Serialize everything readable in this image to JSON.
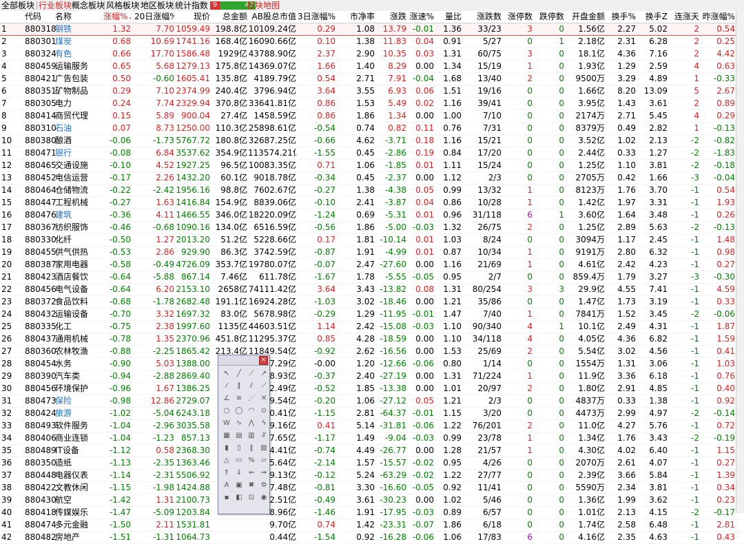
{
  "tabs": [
    {
      "label": "全部板块",
      "active": false
    },
    {
      "label": "行业板块",
      "active": true
    },
    {
      "label": "概念板块",
      "active": false
    },
    {
      "label": "风格板块",
      "active": false
    },
    {
      "label": "地区板块",
      "active": false
    },
    {
      "label": "统计指数",
      "active": false
    }
  ],
  "indicator": {
    "up": "9",
    "down": "47"
  },
  "map_tab": "板块地图",
  "columns": {
    "idx": "",
    "code": "代码",
    "name": "名称",
    "chg": "涨幅%↓",
    "chg20": "20日涨幅%",
    "price": "现价",
    "amt": "总金额",
    "mcap": "AB股总市值",
    "chg3": "3日涨幅%",
    "pb": "市净率",
    "updn": "涨跌",
    "speed": "涨速%",
    "vr": "量比",
    "ratio": "涨跌数",
    "lu": "涨停数",
    "ld": "跌停数",
    "open": "开盘金额",
    "turn": "换手%",
    "turn2": "换手Z",
    "cons": "连涨天",
    "yest": "昨涨幅%"
  },
  "rows": [
    [
      "1",
      "880318",
      "钢铁",
      "1.32",
      "7.70",
      "1059.49",
      "198.8亿",
      "10109.24亿",
      "0.29",
      "1.08",
      "13.79",
      "-0.01",
      "1.36",
      "33/23",
      "3",
      "0",
      "1.56亿",
      "2.27",
      "5.02",
      "2",
      "0.54"
    ],
    [
      "2",
      "880301",
      "煤炭",
      "0.68",
      "10.69",
      "1741.16",
      "168.4亿",
      "16090.66亿",
      "0.10",
      "1.38",
      "11.83",
      "0.04",
      "0.91",
      "5/27",
      "0",
      "1",
      "2.18亿",
      "2.31",
      "6.28",
      "2",
      "0.25"
    ],
    [
      "3",
      "880324",
      "有色",
      "0.66",
      "17.70",
      "1586.48",
      "1929亿",
      "43788.90亿",
      "2.37",
      "2.90",
      "10.35",
      "0.03",
      "1.31",
      "60/75",
      "3",
      "0",
      "18.1亿",
      "4.36",
      "7.16",
      "2",
      "4.42"
    ],
    [
      "4",
      "880459",
      "运输服务",
      "0.65",
      "5.68",
      "1279.13",
      "175.8亿",
      "14369.07亿",
      "1.66",
      "1.40",
      "8.29",
      "0.00",
      "1.34",
      "15/19",
      "1",
      "0",
      "1.93亿",
      "1.29",
      "2.59",
      "4",
      "0.63"
    ],
    [
      "5",
      "880421",
      "广告包装",
      "0.50",
      "-0.60",
      "1605.41",
      "135.8亿",
      "4189.79亿",
      "0.54",
      "2.71",
      "7.91",
      "-0.04",
      "1.68",
      "13/40",
      "2",
      "0",
      "9500万",
      "3.29",
      "4.89",
      "1",
      "-0.33"
    ],
    [
      "6",
      "880351",
      "矿物制品",
      "0.29",
      "7.10",
      "2374.99",
      "240.4亿",
      "3796.94亿",
      "3.64",
      "3.55",
      "6.93",
      "0.06",
      "1.51",
      "19/16",
      "0",
      "0",
      "1.66亿",
      "8.20",
      "13.09",
      "5",
      "2.67"
    ],
    [
      "7",
      "880305",
      "电力",
      "0.24",
      "7.74",
      "2329.94",
      "370.8亿",
      "33641.81亿",
      "0.86",
      "1.53",
      "5.49",
      "0.02",
      "1.16",
      "39/41",
      "0",
      "0",
      "3.95亿",
      "1.43",
      "3.61",
      "2",
      "0.89"
    ],
    [
      "8",
      "880414",
      "商贸代理",
      "0.15",
      "5.89",
      "900.04",
      "27.4亿",
      "1458.59亿",
      "0.86",
      "1.86",
      "1.34",
      "0.00",
      "1.00",
      "7/10",
      "0",
      "0",
      "2174万",
      "2.71",
      "5.45",
      "4",
      "0.29"
    ],
    [
      "9",
      "880310",
      "石油",
      "0.07",
      "8.73",
      "1250.00",
      "110.3亿",
      "25898.61亿",
      "-0.54",
      "0.74",
      "0.82",
      "0.11",
      "0.76",
      "7/31",
      "0",
      "0",
      "8379万",
      "0.49",
      "2.82",
      "1",
      "-0.13"
    ],
    [
      "10",
      "880380",
      "酿酒",
      "-0.06",
      "-1.73",
      "5767.72",
      "180.8亿",
      "32687.25亿",
      "-0.66",
      "4.62",
      "-3.71",
      "0.18",
      "1.16",
      "15/21",
      "0",
      "0",
      "3.52亿",
      "1.02",
      "2.13",
      "-2",
      "-0.82"
    ],
    [
      "11",
      "880471",
      "银行",
      "-0.08",
      "6.84",
      "3537.62",
      "354.9亿",
      "113574.21亿",
      "-1.55",
      "0.45",
      "-2.86",
      "0.19",
      "0.84",
      "17/20",
      "0",
      "0",
      "2.44亿",
      "0.33",
      "1.27",
      "-2",
      "-1.83"
    ],
    [
      "12",
      "880465",
      "交通设施",
      "-0.10",
      "4.52",
      "1927.25",
      "96.5亿",
      "10083.35亿",
      "0.71",
      "1.06",
      "-1.85",
      "0.01",
      "1.11",
      "15/24",
      "0",
      "0",
      "1.25亿",
      "1.10",
      "3.81",
      "-2",
      "-0.18"
    ],
    [
      "13",
      "880452",
      "电信运营",
      "-0.17",
      "2.26",
      "1432.20",
      "60.1亿",
      "9018.78亿",
      "-0.34",
      "0.45",
      "-2.37",
      "0.00",
      "1.12",
      "2/3",
      "0",
      "0",
      "2705万",
      "0.42",
      "1.66",
      "-3",
      "-0.04"
    ],
    [
      "14",
      "880464",
      "仓储物流",
      "-0.22",
      "-2.42",
      "1956.16",
      "98.8亿",
      "7602.67亿",
      "-0.27",
      "1.38",
      "-4.38",
      "0.05",
      "0.99",
      "13/32",
      "1",
      "0",
      "8123万",
      "1.76",
      "3.70",
      "-1",
      "0.54"
    ],
    [
      "15",
      "880447",
      "工程机械",
      "-0.27",
      "1.63",
      "1416.84",
      "154.9亿",
      "8839.06亿",
      "-0.10",
      "2.41",
      "-3.87",
      "0.04",
      "0.86",
      "10/28",
      "1",
      "0",
      "1.42亿",
      "1.97",
      "3.31",
      "-1",
      "1.93"
    ],
    [
      "16",
      "880476",
      "建筑",
      "-0.36",
      "4.11",
      "1466.55",
      "346.0亿",
      "18220.09亿",
      "-1.24",
      "0.69",
      "-5.31",
      "0.01",
      "0.96",
      "31/118",
      "6",
      "1",
      "3.60亿",
      "1.64",
      "3.48",
      "-1",
      "0.26"
    ],
    [
      "17",
      "880367",
      "纺织服饰",
      "-0.46",
      "-0.68",
      "1090.16",
      "134.0亿",
      "6516.59亿",
      "-0.56",
      "1.86",
      "-5.00",
      "-0.03",
      "1.32",
      "26/75",
      "2",
      "0",
      "1.25亿",
      "2.89",
      "5.63",
      "-2",
      "-0.13"
    ],
    [
      "18",
      "880330",
      "化纤",
      "-0.50",
      "1.27",
      "2013.20",
      "51.2亿",
      "5228.66亿",
      "0.17",
      "1.81",
      "-10.14",
      "0.01",
      "1.03",
      "8/24",
      "0",
      "0",
      "3094万",
      "1.17",
      "2.45",
      "-1",
      "1.48"
    ],
    [
      "19",
      "880455",
      "供气供热",
      "-0.53",
      "2.86",
      "929.90",
      "86.3亿",
      "3742.59亿",
      "-0.87",
      "1.91",
      "-4.99",
      "0.01",
      "0.87",
      "10/34",
      "1",
      "0",
      "9191万",
      "2.80",
      "6.32",
      "-1",
      "0.98"
    ],
    [
      "20",
      "880387",
      "家用电器",
      "-0.58",
      "-0.49",
      "4726.09",
      "353.7亿",
      "19780.07亿",
      "-0.07",
      "2.47",
      "-27.60",
      "0.00",
      "1.16",
      "21/69",
      "1",
      "0",
      "4.61亿",
      "2.42",
      "4.23",
      "-1",
      "0.27"
    ],
    [
      "21",
      "880423",
      "酒店餐饮",
      "-0.64",
      "-5.88",
      "867.14",
      "7.46亿",
      "611.78亿",
      "-1.67",
      "1.78",
      "-5.55",
      "-0.05",
      "0.95",
      "2/7",
      "0",
      "0",
      "859.4万",
      "1.79",
      "3.27",
      "-3",
      "-0.30"
    ],
    [
      "22",
      "880456",
      "电气设备",
      "-0.64",
      "6.20",
      "2153.10",
      "2658亿",
      "74111.42亿",
      "3.64",
      "3.43",
      "-13.82",
      "0.08",
      "1.31",
      "80/254",
      "3",
      "3",
      "29.9亿",
      "4.55",
      "7.41",
      "-1",
      "4.59"
    ],
    [
      "23",
      "880372",
      "食品饮料",
      "-0.68",
      "-1.78",
      "2682.48",
      "191.1亿",
      "16924.28亿",
      "-1.03",
      "3.02",
      "-18.46",
      "0.00",
      "1.21",
      "35/86",
      "0",
      "0",
      "1.47亿",
      "1.73",
      "3.19",
      "-1",
      "0.33"
    ],
    [
      "24",
      "880432",
      "运输设备",
      "-0.70",
      "3.32",
      "1697.32",
      "83.0亿",
      "5678.98亿",
      "-0.29",
      "1.29",
      "-11.95",
      "-0.01",
      "1.47",
      "7/40",
      "1",
      "0",
      "7841万",
      "1.52",
      "3.45",
      "-2",
      "-0.06"
    ],
    [
      "25",
      "880335",
      "化工",
      "-0.75",
      "2.38",
      "1997.60",
      "1135亿",
      "44603.51亿",
      "1.14",
      "2.42",
      "-15.08",
      "-0.03",
      "1.10",
      "90/340",
      "4",
      "1",
      "10.1亿",
      "2.49",
      "4.31",
      "-1",
      "1.87"
    ],
    [
      "26",
      "880437",
      "通用机械",
      "-0.78",
      "1.35",
      "2370.96",
      "451.8亿",
      "11295.37亿",
      "0.85",
      "4.28",
      "-18.59",
      "0.00",
      "1.10",
      "34/118",
      "4",
      "0",
      "4.05亿",
      "4.36",
      "6.82",
      "-1",
      "1.59"
    ],
    [
      "27",
      "880360",
      "农林牧渔",
      "-0.88",
      "-2.25",
      "1865.42",
      "213.4亿",
      "11849.54亿",
      "-0.92",
      "2.62",
      "-16.56",
      "0.00",
      "1.53",
      "25/69",
      "2",
      "0",
      "5.54亿",
      "3.02",
      "4.56",
      "-1",
      "0.41"
    ],
    [
      "28",
      "880454",
      "水务",
      "-0.90",
      "5.03",
      "1388.00",
      "21.7亿",
      "1507.29亿",
      "-0.00",
      "1.20",
      "-12.66",
      "-0.06",
      "0.80",
      "1/14",
      "0",
      "0",
      "1554万",
      "1.31",
      "3.06",
      "-1",
      "1.03"
    ],
    [
      "29",
      "880390",
      "汽车类",
      "-0.94",
      "-2.88",
      "2869.40",
      "",
      "",
      "-0.37",
      "2.40",
      "-27.19",
      "0.00",
      "1.31",
      "71/224",
      "1",
      "0",
      "11.9亿",
      "3.36",
      "6.18",
      "-1",
      "0.76"
    ],
    [
      "30",
      "880456",
      "环境保护",
      "-0.96",
      "1.67",
      "1386.25",
      "",
      "",
      "-0.52",
      "1.85",
      "-13.38",
      "0.00",
      "1.01",
      "20/97",
      "2",
      "0",
      "1.80亿",
      "2.91",
      "4.85",
      "-1",
      "0.40"
    ],
    [
      "31",
      "880473",
      "保险",
      "-0.98",
      "12.86",
      "2729.07",
      "",
      "",
      "-0.20",
      "1.06",
      "-27.12",
      "0.05",
      "1.21",
      "2/3",
      "0",
      "0",
      "4837万",
      "0.33",
      "1.38",
      "-1",
      "0.92"
    ],
    [
      "32",
      "880424",
      "旅游",
      "-1.02",
      "-5.04",
      "6243.18",
      "",
      "",
      "-1.15",
      "2.81",
      "-64.37",
      "-0.01",
      "1.15",
      "3/20",
      "0",
      "0",
      "4473万",
      "2.99",
      "4.97",
      "-2",
      "-0.14"
    ],
    [
      "33",
      "880493",
      "软件服务",
      "-1.04",
      "-2.96",
      "3035.58",
      "",
      "",
      "0.41",
      "5.14",
      "-31.81",
      "-0.06",
      "1.22",
      "76/201",
      "2",
      "0",
      "11.0亿",
      "4.27",
      "5.76",
      "-1",
      "0.72"
    ],
    [
      "34",
      "880406",
      "商业连锁",
      "-1.04",
      "-1.23",
      "857.13",
      "",
      "",
      "-1.17",
      "1.49",
      "-9.04",
      "-0.03",
      "0.99",
      "23/78",
      "1",
      "0",
      "1.34亿",
      "1.76",
      "3.43",
      "-2",
      "-0.19"
    ],
    [
      "35",
      "880489",
      "IT设备",
      "-1.12",
      "0.58",
      "2368.30",
      "",
      "",
      "-0.74",
      "4.49",
      "-26.77",
      "0.00",
      "1.28",
      "21/57",
      "1",
      "0",
      "4.30亿",
      "4.02",
      "6.40",
      "-1",
      "1.15"
    ],
    [
      "36",
      "880350",
      "造纸",
      "-1.13",
      "-2.35",
      "1363.46",
      "",
      "",
      "-2.14",
      "1.57",
      "-15.57",
      "-0.02",
      "0.95",
      "4/26",
      "0",
      "0",
      "2070万",
      "2.61",
      "4.07",
      "-1",
      "0.27"
    ],
    [
      "37",
      "880448",
      "电器仪表",
      "-1.14",
      "-2.31",
      "5506.92",
      "",
      "",
      "-0.12",
      "5.24",
      "-63.29",
      "-0.02",
      "1.22",
      "27/77",
      "0",
      "0",
      "2.39亿",
      "3.66",
      "5.84",
      "-1",
      "1.39"
    ],
    [
      "38",
      "880422",
      "文教休闲",
      "-1.15",
      "-1.98",
      "1424.88",
      "",
      "",
      "-0.81",
      "3.30",
      "-16.60",
      "-0.05",
      "0.92",
      "11/41",
      "0",
      "0",
      "5590万",
      "2.34",
      "3.81",
      "-1",
      "0.34"
    ],
    [
      "39",
      "880430",
      "航空",
      "-1.42",
      "1.31",
      "2100.73",
      "",
      "",
      "-0.49",
      "3.61",
      "-30.23",
      "0.00",
      "1.02",
      "5/46",
      "0",
      "0",
      "1.36亿",
      "1.99",
      "3.62",
      "-1",
      "0.23"
    ],
    [
      "40",
      "880418",
      "传媒娱乐",
      "-1.47",
      "-5.09",
      "1203.84",
      "",
      "",
      "-1.46",
      "1.91",
      "-17.95",
      "-0.03",
      "0.89",
      "6/57",
      "0",
      "0",
      "1.01亿",
      "2.13",
      "4.15",
      "-2",
      "-0.17"
    ],
    [
      "41",
      "880474",
      "多元金融",
      "-1.50",
      "2.11",
      "1531.81",
      "",
      "",
      "0.74",
      "1.42",
      "-23.31",
      "-0.07",
      "1.86",
      "6/18",
      "0",
      "0",
      "1.74亿",
      "2.58",
      "6.48",
      "-1",
      "2.81"
    ],
    [
      "42",
      "880482",
      "房地产",
      "-1.51",
      "-1.31",
      "1064.73",
      "",
      "",
      "-1.54",
      "0.92",
      "-16.28",
      "-0.06",
      "1.06",
      "17/83",
      "6",
      "0",
      "4.16亿",
      "2.35",
      "4.63",
      "-1",
      "0.43"
    ]
  ],
  "partial_mcap": {
    "29": "48.93亿",
    "30": "2.49亿",
    "31": "9.54亿",
    "32": "0.41亿",
    "33": "9.16亿",
    "34": "7.65亿",
    "35": "4.41亿",
    "36": "5.64亿",
    "37": "9.13亿",
    "38": "7.48亿",
    "39": "2.51亿",
    "40": "8.96亿",
    "41": "9.70亿",
    "42": "0.44亿"
  },
  "blue_names": [
    "钢铁",
    "煤炭",
    "有色",
    "石油",
    "银行",
    "建筑",
    "保险",
    "旅游"
  ],
  "colors": {
    "up": "#e02020",
    "down": "#008000",
    "accent": "#1a6fd0",
    "limit_down_highlight": "#c000c0"
  }
}
